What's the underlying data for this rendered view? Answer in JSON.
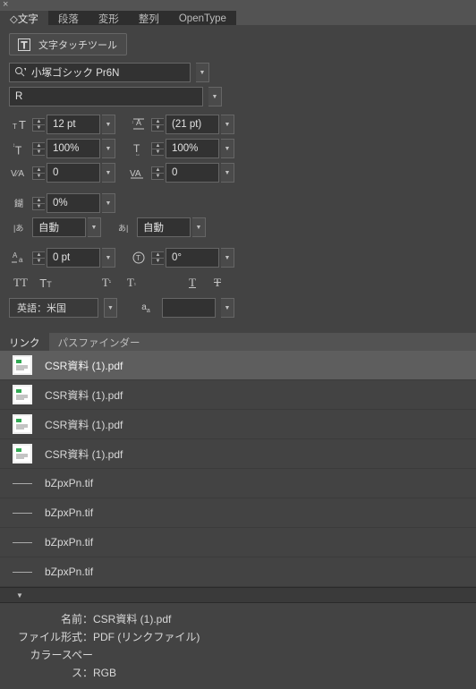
{
  "topbar": {},
  "tabs": {
    "character": "文字",
    "paragraph": "段落",
    "transform": "変形",
    "align": "整列",
    "opentype": "OpenType"
  },
  "touch_tool": {
    "label": "文字タッチツール"
  },
  "font": {
    "family": "小塚ゴシック Pr6N",
    "style": "R"
  },
  "size": {
    "value": "12 pt",
    "leading": "(21 pt)"
  },
  "scale": {
    "v": "100%",
    "h": "100%"
  },
  "tracking": {
    "va": "0",
    "av": "0"
  },
  "tsume": {
    "value": "0%"
  },
  "aki": {
    "left": "自動",
    "right": "自動"
  },
  "baseline": {
    "shift": "0 pt",
    "rotation": "0°"
  },
  "lang": {
    "value": "英語：米国"
  },
  "links_tabs": {
    "links": "リンク",
    "pathfinder": "パスファインダー"
  },
  "links": [
    {
      "name": "CSR資料 (1).pdf",
      "thumb": "pdf",
      "selected": true
    },
    {
      "name": "CSR資料 (1).pdf",
      "thumb": "pdf"
    },
    {
      "name": "CSR資料 (1).pdf",
      "thumb": "pdf"
    },
    {
      "name": "CSR資料 (1).pdf",
      "thumb": "pdf"
    },
    {
      "name": "bZpxPn.tif",
      "thumb": "line"
    },
    {
      "name": "bZpxPn.tif",
      "thumb": "line"
    },
    {
      "name": "bZpxPn.tif",
      "thumb": "line"
    },
    {
      "name": "bZpxPn.tif",
      "thumb": "line"
    }
  ],
  "info": {
    "name_label": "名前：",
    "name": "CSR資料 (1).pdf",
    "format_label": "ファイル形式：",
    "format": "PDF (リンクファイル)",
    "colorspace_label": "カラースペース：",
    "colorspace": "RGB"
  }
}
